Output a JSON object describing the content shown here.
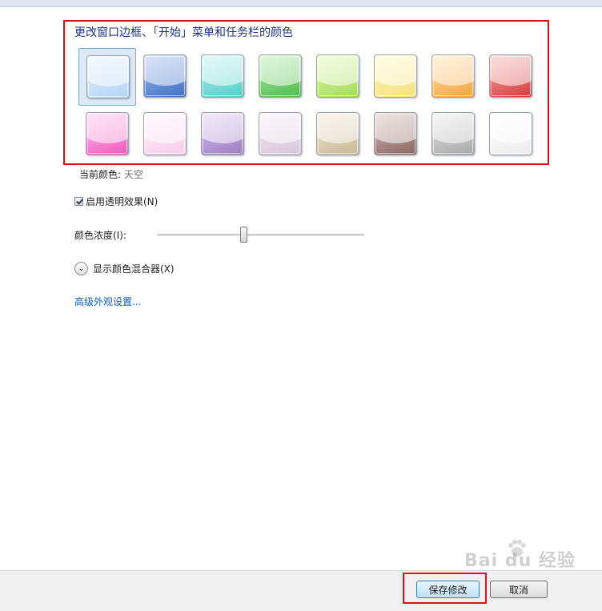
{
  "heading": "更改窗口边框、「开始」菜单和任务栏的颜色",
  "swatches": [
    {
      "name": "sky",
      "top": "#e4f1ff",
      "bottom": "#b3d4f5",
      "selected": true
    },
    {
      "name": "twilight",
      "top": "#a9c1ea",
      "bottom": "#3e6fc4"
    },
    {
      "name": "sea",
      "top": "#bff0ee",
      "bottom": "#4fcfc8"
    },
    {
      "name": "leaf",
      "top": "#b8ecb0",
      "bottom": "#4bbb4c"
    },
    {
      "name": "lime",
      "top": "#e3f8b8",
      "bottom": "#a4dc55"
    },
    {
      "name": "sun",
      "top": "#fff8c4",
      "bottom": "#f6e27a"
    },
    {
      "name": "pumpkin",
      "top": "#ffe0b4",
      "bottom": "#f6a53c"
    },
    {
      "name": "ruby",
      "top": "#f5b5b5",
      "bottom": "#d63a3a"
    },
    {
      "name": "fuchsia",
      "top": "#ffc4ea",
      "bottom": "#ef5bbf"
    },
    {
      "name": "blush",
      "top": "#fff0fb",
      "bottom": "#f9cdea"
    },
    {
      "name": "violet",
      "top": "#dccdf0",
      "bottom": "#9c7bc4"
    },
    {
      "name": "lavender",
      "top": "#f3ecf4",
      "bottom": "#d7c6da"
    },
    {
      "name": "taupe",
      "top": "#efe8da",
      "bottom": "#c9b994"
    },
    {
      "name": "chocolate",
      "top": "#d4c0bc",
      "bottom": "#8a6462"
    },
    {
      "name": "slate",
      "top": "#e7e7e7",
      "bottom": "#a7a7a7"
    },
    {
      "name": "frost",
      "top": "#ffffff",
      "bottom": "#ececec"
    }
  ],
  "current_color": {
    "label": "当前颜色:",
    "value": "天空"
  },
  "transparency": {
    "label": "启用透明效果(N)",
    "checked": true
  },
  "intensity": {
    "label": "颜色浓度(I):",
    "value": 0.42
  },
  "mixer": {
    "label": "显示颜色混合器(X)"
  },
  "advanced_link": "高级外观设置...",
  "buttons": {
    "save": "保存修改",
    "cancel": "取消"
  },
  "watermark": "Bai du 经验"
}
